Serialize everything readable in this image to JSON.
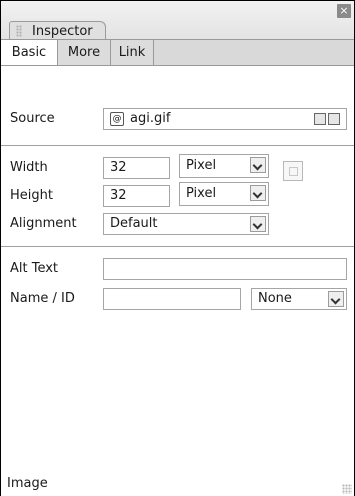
{
  "window": {
    "close_glyph": "×",
    "panel_title": "Inspector"
  },
  "tabs": [
    {
      "label": "Basic",
      "active": true
    },
    {
      "label": "More",
      "active": false
    },
    {
      "label": "Link",
      "active": false
    }
  ],
  "source": {
    "label": "Source",
    "value": "agi.gif",
    "link_glyph": "@"
  },
  "width": {
    "label": "Width",
    "value": "32",
    "unit": "Pixel"
  },
  "height": {
    "label": "Height",
    "value": "32",
    "unit": "Pixel"
  },
  "alignment": {
    "label": "Alignment",
    "value": "Default"
  },
  "alt_text": {
    "label": "Alt Text",
    "value": ""
  },
  "name_id": {
    "label": "Name / ID",
    "value": "",
    "mode": "None"
  },
  "footer": {
    "status": "Image"
  }
}
